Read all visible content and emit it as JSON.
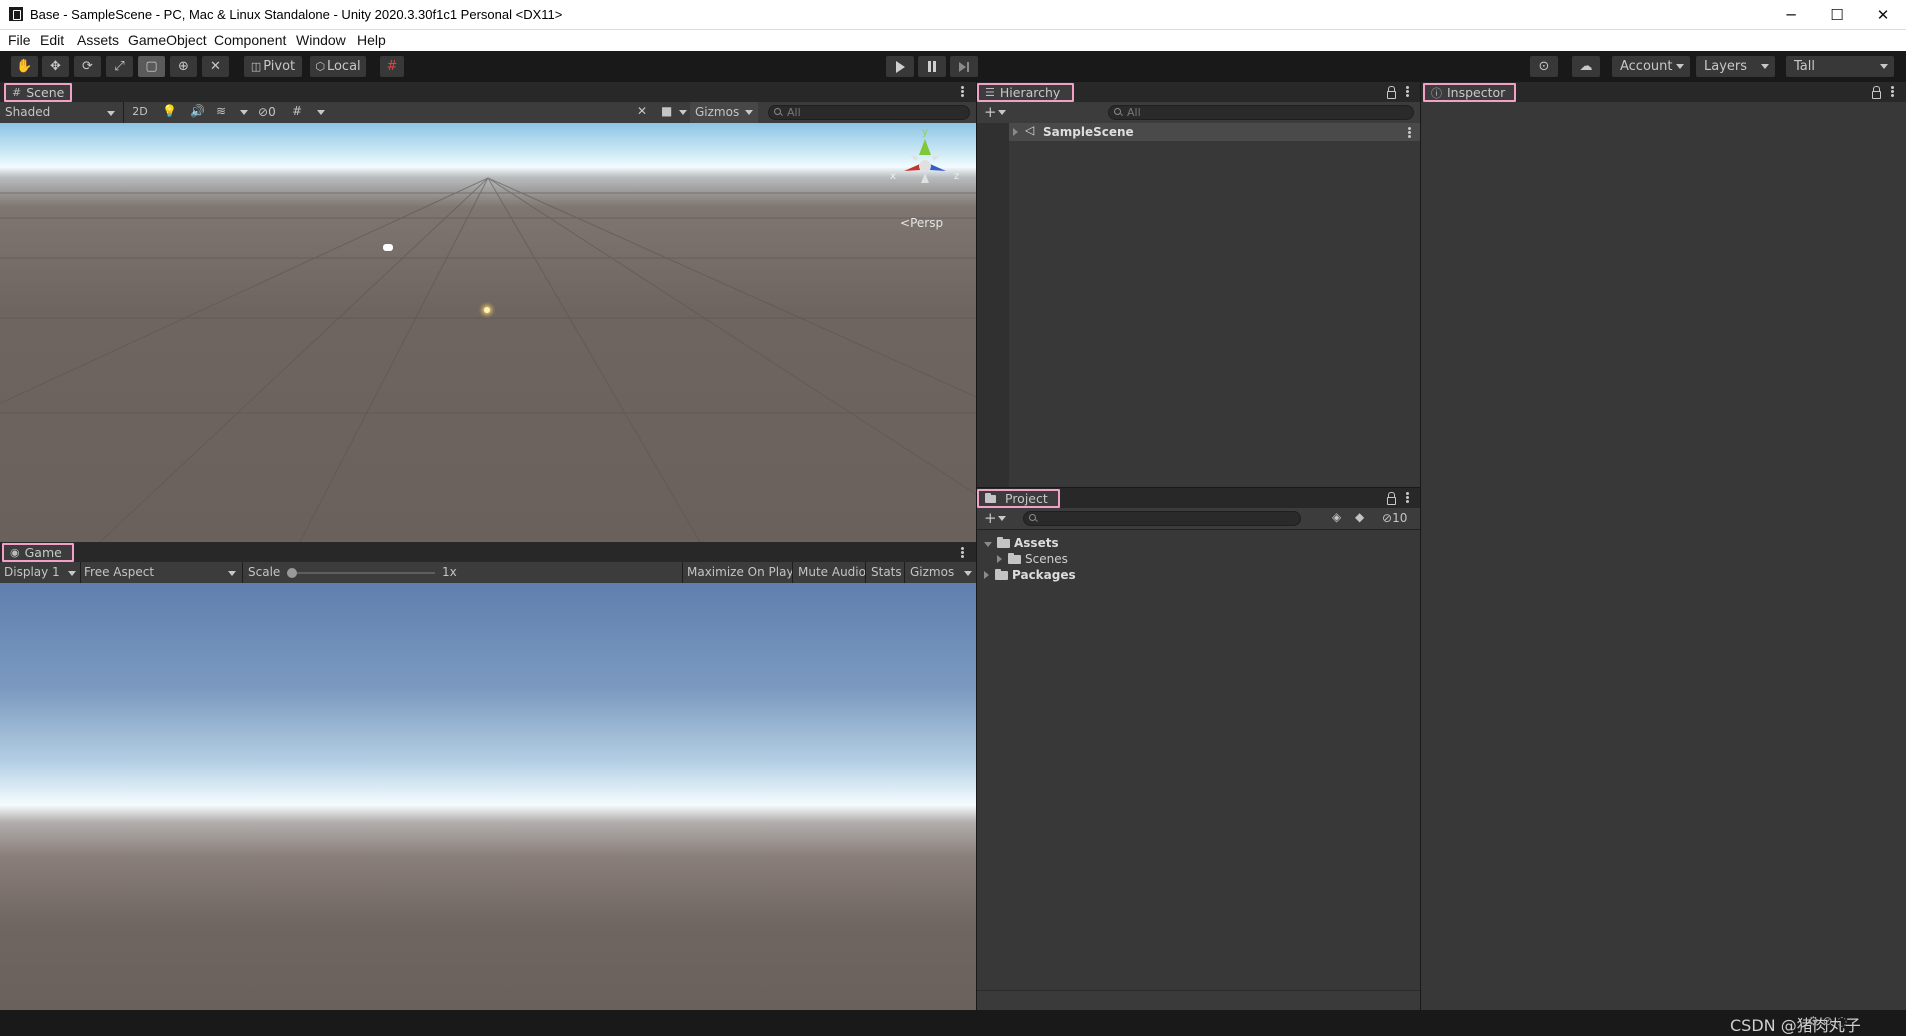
{
  "window": {
    "title": "Base - SampleScene - PC, Mac & Linux Standalone - Unity 2020.3.30f1c1 Personal <DX11>",
    "minimize": "─",
    "maximize": "☐",
    "close": "✕"
  },
  "menu": [
    "File",
    "Edit",
    "Assets",
    "GameObject",
    "Component",
    "Window",
    "Help"
  ],
  "toolbar": {
    "pivot_label": "Pivot",
    "local_label": "Local",
    "account_label": "Account",
    "layers_label": "Layers",
    "layout_label": "Tall"
  },
  "scene": {
    "tab_label": "Scene",
    "draw_mode": "Shaded",
    "mode_2d": "2D",
    "hidden_count": "0",
    "gizmos_label": "Gizmos",
    "search_placeholder": "All",
    "projection_label": "Persp",
    "axis_x": "x",
    "axis_y": "y",
    "axis_z": "z"
  },
  "game": {
    "tab_label": "Game",
    "display": "Display 1",
    "aspect": "Free Aspect",
    "scale_label": "Scale",
    "scale_value": "1x",
    "maximize_on_play": "Maximize On Play",
    "mute_audio": "Mute Audio",
    "stats": "Stats",
    "gizmos_label": "Gizmos"
  },
  "hierarchy": {
    "tab_label": "Hierarchy",
    "search_placeholder": "All",
    "scene_item": "SampleScene"
  },
  "project": {
    "tab_label": "Project",
    "hidden_count": "10",
    "tree": {
      "assets": "Assets",
      "scenes": "Scenes",
      "packages": "Packages"
    }
  },
  "inspector": {
    "tab_label": "Inspector"
  },
  "watermark": "CSDN @猪肉丸子",
  "colors": {
    "tab_highlight": "#f2a0c8",
    "panel_bg": "#383838",
    "toolbar_bg": "#191919"
  }
}
